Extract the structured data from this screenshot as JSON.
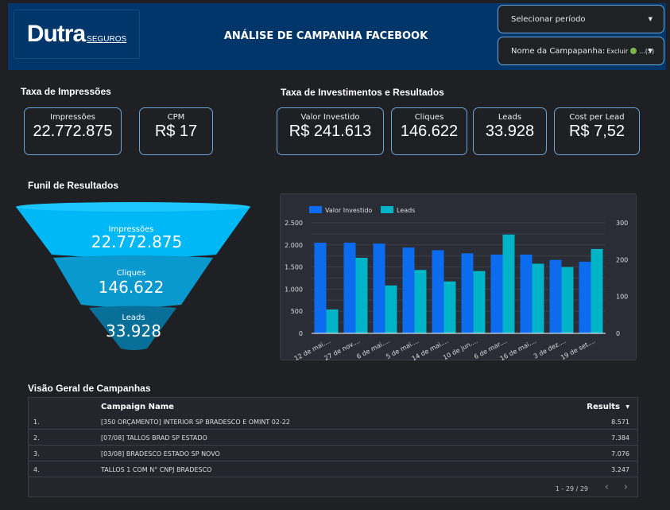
{
  "header": {
    "logo_main": "Dutra",
    "logo_sub": "SEGUROS",
    "title": "ANÁLISE DE CAMPANHA FACEBOOK",
    "period_filter": "Selecionar período",
    "campaign_filter": {
      "label": "Nome da Campapanha:",
      "value": "Excluir",
      "suffix": "...(5)"
    }
  },
  "impressions_section": {
    "title": "Taxa de Impressões",
    "cards": [
      {
        "label": "Impressões",
        "value": "22.772.875"
      },
      {
        "label": "CPM",
        "value": "R$ 17"
      }
    ]
  },
  "investment_section": {
    "title": "Taxa de Investimentos e Resultados",
    "cards": [
      {
        "label": "Valor Investido",
        "value": "R$ 241.613"
      },
      {
        "label": "Cliques",
        "value": "146.622"
      },
      {
        "label": "Leads",
        "value": "33.928"
      },
      {
        "label": "Cost per Lead",
        "value": "R$ 7,52"
      }
    ]
  },
  "funnel": {
    "title": "Funil de Resultados",
    "stages": [
      {
        "label": "Impressões",
        "value": "22.772.875",
        "color": "#00b8f5"
      },
      {
        "label": "Cliques",
        "value": "146.622",
        "color": "#0a99cf"
      },
      {
        "label": "Leads",
        "value": "33.928",
        "color": "#086f98"
      }
    ]
  },
  "chart_data": {
    "type": "bar",
    "categories": [
      "12 de mai....",
      "27 de nov....",
      "6 de mai....",
      "5 de mai....",
      "14 de mai....",
      "10 de jun....",
      "6 de mar....",
      "16 de mai....",
      "3 de dez....",
      "19 de set...."
    ],
    "series": [
      {
        "name": "Valor Investido",
        "axis": "left",
        "color": "#0b6cf0",
        "values": [
          2050,
          2050,
          2030,
          1940,
          1880,
          1810,
          1780,
          1780,
          1660,
          1620
        ]
      },
      {
        "name": "Leads",
        "axis": "right",
        "color": "#00b4c8",
        "values": [
          65,
          205,
          130,
          172,
          141,
          169,
          268,
          189,
          180,
          229
        ]
      }
    ],
    "ylim_left": [
      0,
      2500
    ],
    "yticks_left": [
      "0",
      "500",
      "1.000",
      "1.500",
      "2.000",
      "2.500"
    ],
    "ylim_right": [
      0,
      300
    ],
    "yticks_right": [
      "0",
      "100",
      "200",
      "300"
    ],
    "legend": "top-left",
    "grid": true
  },
  "table": {
    "title": "Visão Geral de Campanhas",
    "columns": [
      "Campaign Name",
      "Results"
    ],
    "rows": [
      {
        "n": "1.",
        "name": "[350 ORÇAMENTO] INTERIOR SP BRADESCO E OMINT 02-22",
        "results": "8.571"
      },
      {
        "n": "2.",
        "name": "[07/08] TALLOS BRAD SP ESTADO",
        "results": "7.384"
      },
      {
        "n": "3.",
        "name": "[03/08] BRADESCO ESTADO SP NOVO",
        "results": "7.076"
      },
      {
        "n": "4.",
        "name": "TALLOS 1 COM N° CNPJ BRADESCO",
        "results": "3.247"
      }
    ],
    "pagination": "1 - 29 / 29"
  }
}
